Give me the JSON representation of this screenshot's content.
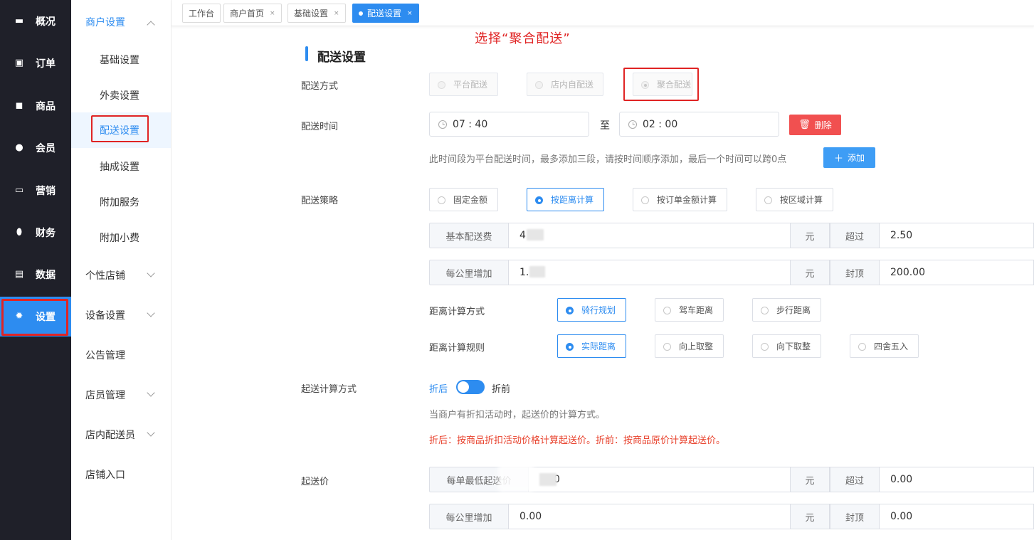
{
  "nav": {
    "items": [
      {
        "label": "概况",
        "icon": "monitor-icon"
      },
      {
        "label": "订单",
        "icon": "order-icon"
      },
      {
        "label": "商品",
        "icon": "bag-icon"
      },
      {
        "label": "会员",
        "icon": "user-icon"
      },
      {
        "label": "营销",
        "icon": "ticket-icon"
      },
      {
        "label": "财务",
        "icon": "money-bag-icon"
      },
      {
        "label": "数据",
        "icon": "chart-icon"
      },
      {
        "label": "设置",
        "icon": "gear-icon"
      }
    ],
    "active_label": "设置"
  },
  "submenu": {
    "merchant_group": "商户设置",
    "merchant_items": [
      "基础设置",
      "外卖设置",
      "配送设置",
      "抽成设置",
      "附加服务",
      "附加小费"
    ],
    "active_item": "配送设置",
    "groups": [
      "个性店铺",
      "设备设置",
      "公告管理",
      "店员管理",
      "店内配送员",
      "店铺入口"
    ]
  },
  "tabs": [
    {
      "label": "工作台",
      "closable": false
    },
    {
      "label": "商户首页",
      "closable": true
    },
    {
      "label": "基础设置",
      "closable": true
    },
    {
      "label": "配送设置",
      "closable": true,
      "active": true
    }
  ],
  "close_glyph": "×",
  "annotation": "选择“聚合配送”",
  "section_title": "配送设置",
  "delivery_mode": {
    "label": "配送方式",
    "options": [
      "平台配送",
      "店内自配送",
      "聚合配送"
    ],
    "selected": "聚合配送"
  },
  "delivery_time": {
    "label": "配送时间",
    "start": "07 : 40",
    "separator": "至",
    "end": "02 : 00",
    "delete_label": "删除",
    "hint": "此时间段为平台配送时间，最多添加三段，请按时间顺序添加，最后一个时间可以跨0点",
    "add_label": "添加"
  },
  "strategy": {
    "label": "配送策略",
    "options": [
      "固定金额",
      "按距离计算",
      "按订单金额计算",
      "按区域计算"
    ],
    "selected": "按距离计算",
    "base_fee": {
      "prefix": "基本配送费",
      "value": "4",
      "unit": "元",
      "over_label": "超过",
      "over_value": "2.50"
    },
    "per_km": {
      "prefix": "每公里增加",
      "value": "1.",
      "unit": "元",
      "cap_label": "封顶",
      "cap_value": "200.00"
    },
    "distance_method": {
      "label": "距离计算方式",
      "options": [
        "骑行规划",
        "驾车距离",
        "步行距离"
      ],
      "selected": "骑行规划"
    },
    "distance_rule": {
      "label": "距离计算规则",
      "options": [
        "实际距离",
        "向上取整",
        "向下取整",
        "四舍五入"
      ],
      "selected": "实际距离"
    }
  },
  "min_order_calc": {
    "label": "起送计算方式",
    "left": "折后",
    "right": "折前",
    "hint": "当商户有折扣活动时，起送价的计算方式。",
    "hint_red": "折后：按商品折扣活动价格计算起送价。折前：按商品原价计算起送价。"
  },
  "min_price": {
    "label": "起送价",
    "row1": {
      "prefix": "每单最低起送价",
      "value": "0",
      "unit": "元",
      "over_label": "超过",
      "over_value": "0.00"
    },
    "row2": {
      "prefix": "每公里增加",
      "value": "0.00",
      "unit": "元",
      "cap_label": "封顶",
      "cap_value": "0.00"
    }
  },
  "colors": {
    "accent": "#2d8cf0",
    "danger": "#f15050",
    "annotation": "#e02424",
    "nav_bg": "#1f2029"
  }
}
